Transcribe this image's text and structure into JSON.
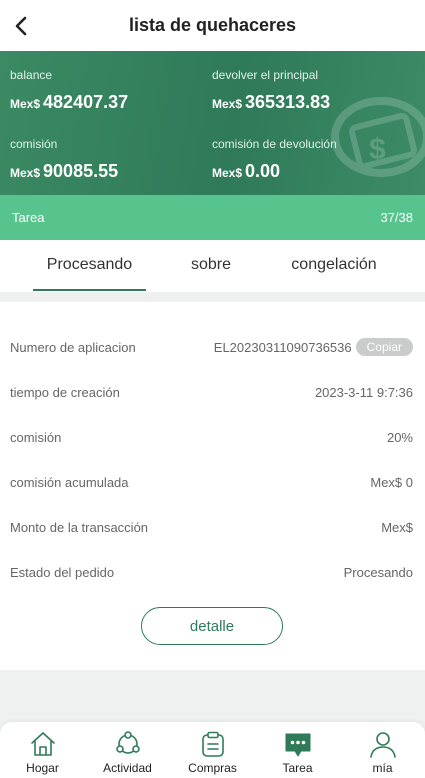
{
  "header": {
    "title": "lista de quehaceres"
  },
  "stats": {
    "balance": {
      "label": "balance",
      "currency": "Mex$",
      "value": "482407.37"
    },
    "principal": {
      "label": "devolver el principal",
      "currency": "Mex$",
      "value": "365313.83"
    },
    "commission": {
      "label": "comisión",
      "currency": "Mex$",
      "value": "90085.55"
    },
    "commission_return": {
      "label": "comisión de devolución",
      "currency": "Mex$",
      "value": "0.00"
    }
  },
  "task_bar": {
    "label": "Tarea",
    "progress": "37/38"
  },
  "tabs": [
    {
      "label": "Procesando",
      "active": true
    },
    {
      "label": "sobre",
      "active": false
    },
    {
      "label": "congelación",
      "active": false
    }
  ],
  "details": {
    "application_number": {
      "label": "Numero de aplicacion",
      "value": "EL20230311090736536",
      "copy_label": "Copiar"
    },
    "created_time": {
      "label": "tiempo de creación",
      "value": "2023-3-11 9:7:36"
    },
    "commission": {
      "label": "comisión",
      "value": "20%"
    },
    "accumulated_commission": {
      "label": "comisión acumulada",
      "value": "Mex$ 0"
    },
    "transaction_amount": {
      "label": "Monto de la transacción",
      "value": "Mex$"
    },
    "order_status": {
      "label": "Estado del pedido",
      "value": "Procesando"
    },
    "detail_button": "detalle"
  },
  "nav": [
    {
      "label": "Hogar",
      "icon": "home-icon"
    },
    {
      "label": "Actividad",
      "icon": "activity-icon"
    },
    {
      "label": "Compras",
      "icon": "clipboard-icon"
    },
    {
      "label": "Tarea",
      "icon": "chat-icon",
      "active": true
    },
    {
      "label": "mía",
      "icon": "user-icon"
    }
  ],
  "colors": {
    "primary": "#2f7a59",
    "taskbar": "#57c48e"
  }
}
